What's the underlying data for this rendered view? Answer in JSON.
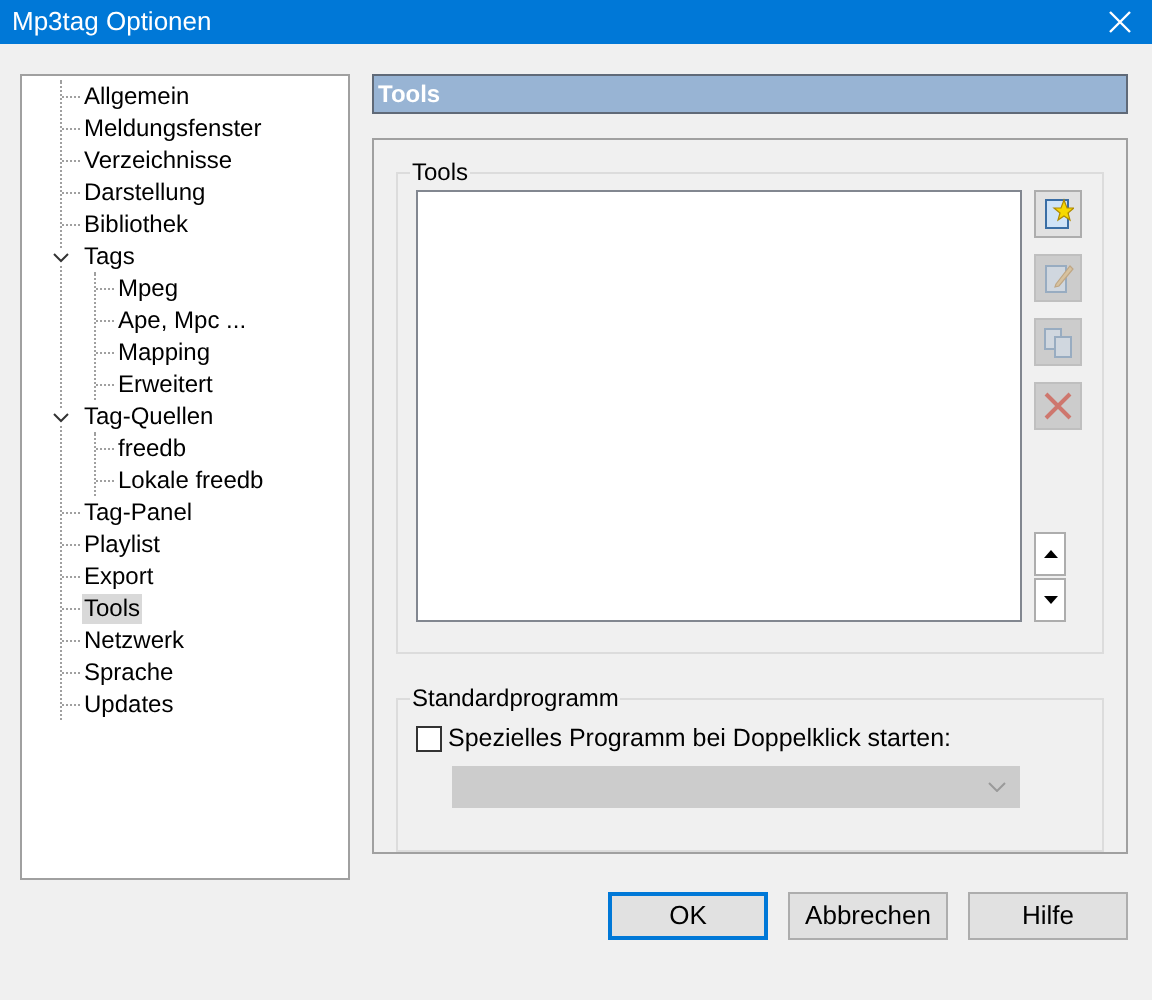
{
  "window": {
    "title": "Mp3tag Optionen"
  },
  "tree": [
    {
      "label": "Allgemein",
      "selected": false
    },
    {
      "label": "Meldungsfenster",
      "selected": false
    },
    {
      "label": "Verzeichnisse",
      "selected": false
    },
    {
      "label": "Darstellung",
      "selected": false
    },
    {
      "label": "Bibliothek",
      "selected": false
    },
    {
      "label": "Tags",
      "selected": false,
      "expanded": true,
      "children": [
        {
          "label": "Mpeg",
          "selected": false
        },
        {
          "label": "Ape, Mpc ...",
          "selected": false
        },
        {
          "label": "Mapping",
          "selected": false
        },
        {
          "label": "Erweitert",
          "selected": false
        }
      ]
    },
    {
      "label": "Tag-Quellen",
      "selected": false,
      "expanded": true,
      "children": [
        {
          "label": "freedb",
          "selected": false
        },
        {
          "label": "Lokale freedb",
          "selected": false
        }
      ]
    },
    {
      "label": "Tag-Panel",
      "selected": false
    },
    {
      "label": "Playlist",
      "selected": false
    },
    {
      "label": "Export",
      "selected": false
    },
    {
      "label": "Tools",
      "selected": true
    },
    {
      "label": "Netzwerk",
      "selected": false
    },
    {
      "label": "Sprache",
      "selected": false
    },
    {
      "label": "Updates",
      "selected": false
    }
  ],
  "page_header": "Tools",
  "tools_group": {
    "title": "Tools",
    "actions": [
      {
        "kind": "new",
        "disabled": false
      },
      {
        "kind": "edit",
        "disabled": true
      },
      {
        "kind": "copy",
        "disabled": true
      },
      {
        "kind": "delete",
        "disabled": true
      }
    ]
  },
  "default_group": {
    "title": "Standardprogramm",
    "checkbox": {
      "label": "Spezielles Programm bei Doppelklick starten:",
      "checked": false
    },
    "combo": {
      "disabled": true
    }
  },
  "buttons": [
    {
      "label": "OK",
      "default": true
    },
    {
      "label": "Abbrechen",
      "default": false
    },
    {
      "label": "Hilfe",
      "default": false
    }
  ]
}
